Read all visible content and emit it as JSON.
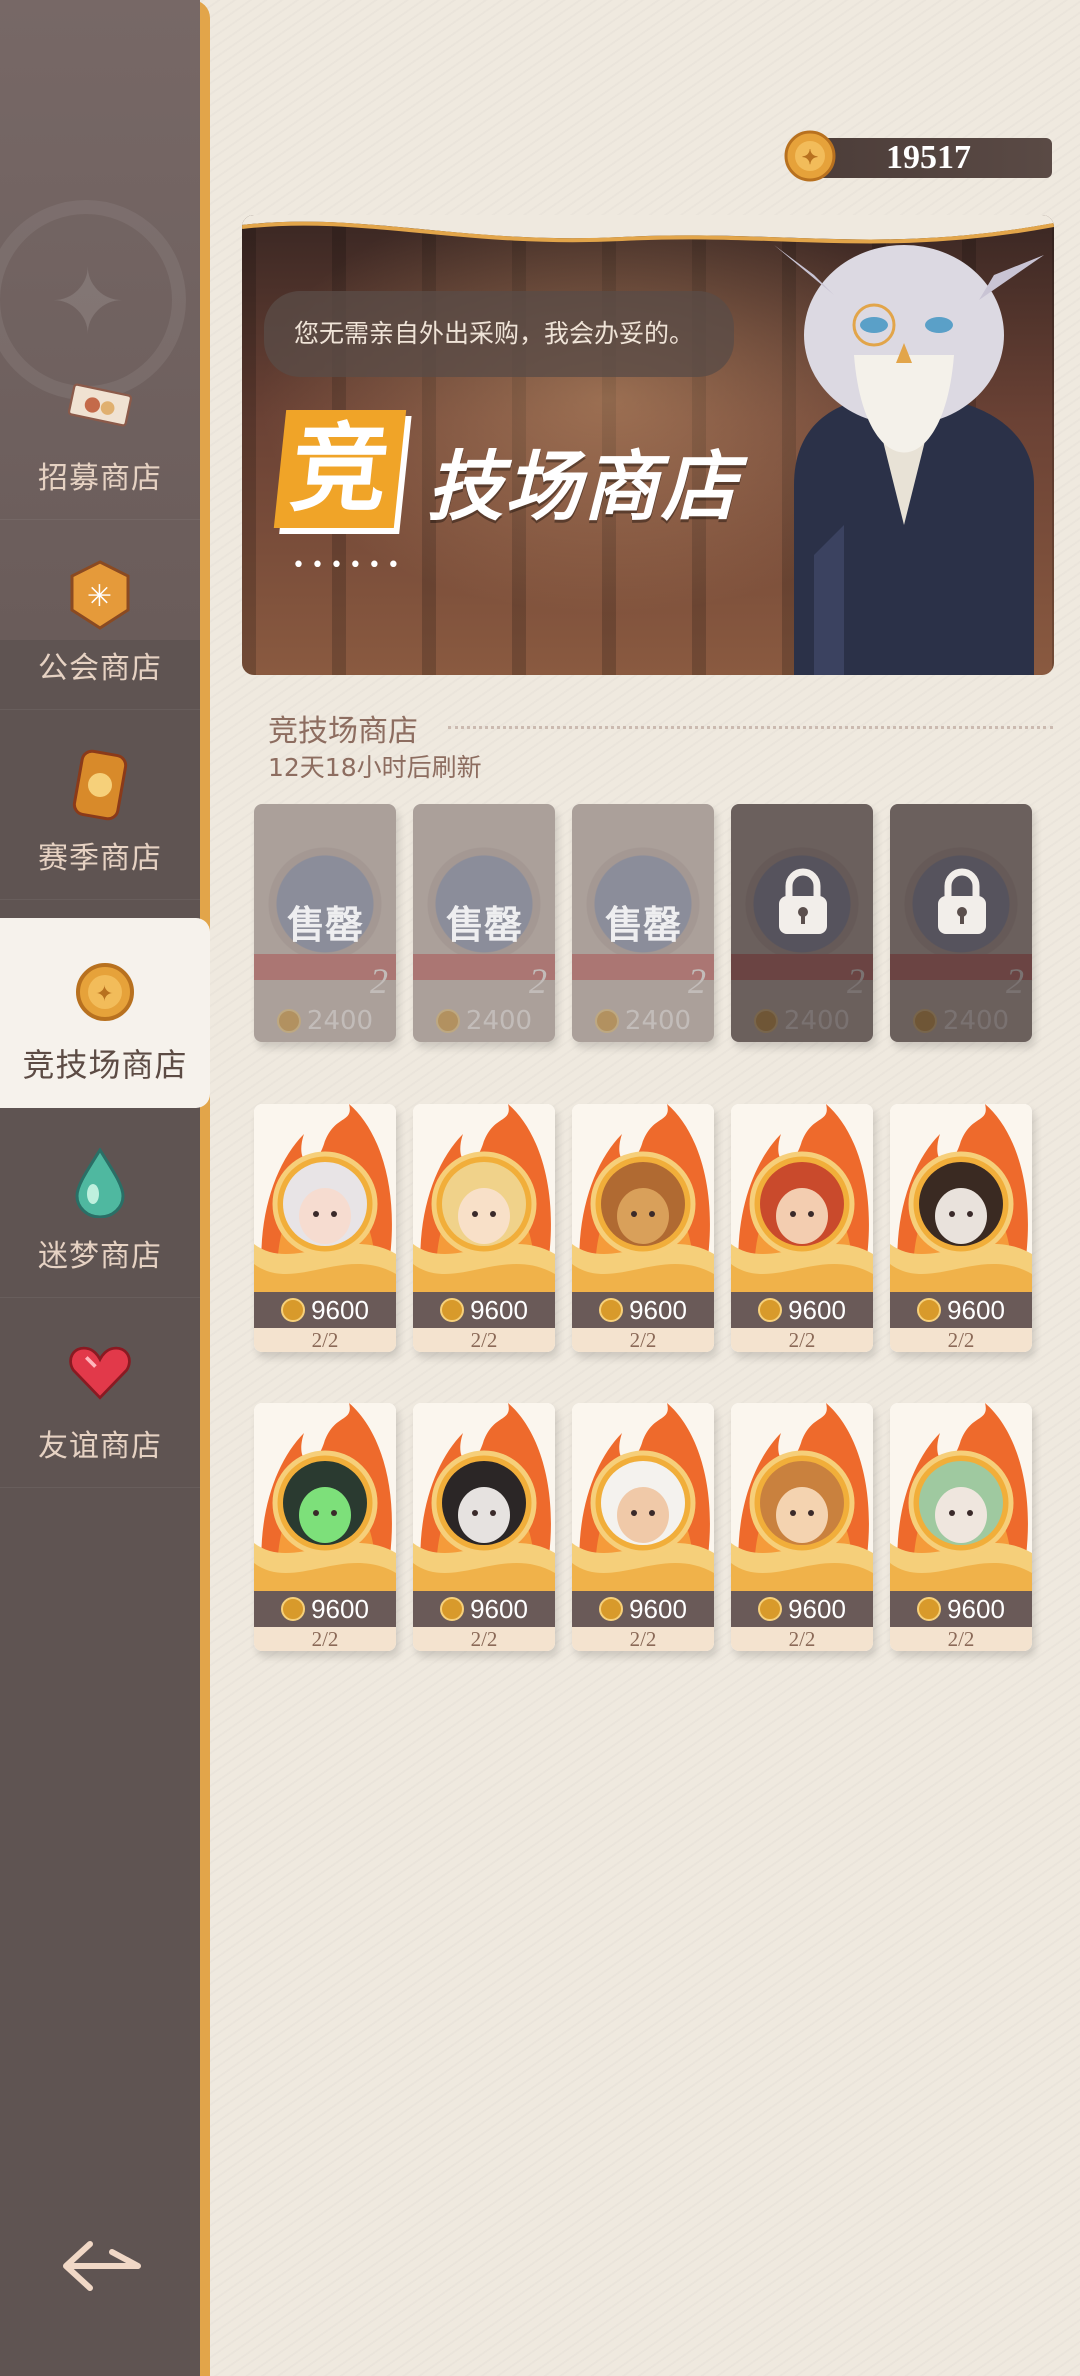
{
  "currency": {
    "amount": "19517",
    "icon": "arena-coin-icon"
  },
  "sidebar": {
    "items": [
      {
        "label": "招募商店",
        "icon": "recruit-ticket-icon"
      },
      {
        "label": "公会商店",
        "icon": "guild-badge-icon"
      },
      {
        "label": "赛季商店",
        "icon": "season-token-icon"
      },
      {
        "label": "竞技场商店",
        "icon": "arena-coin-icon",
        "active": true
      },
      {
        "label": "迷梦商店",
        "icon": "dream-drop-icon"
      },
      {
        "label": "友谊商店",
        "icon": "heart-gem-icon"
      }
    ],
    "back_icon": "back-arrow-icon"
  },
  "banner": {
    "speech": "您无需亲自外出采购，我会办妥的。",
    "title_first": "竞",
    "title_rest": "技场商店",
    "dots": "••••••"
  },
  "section": {
    "title": "竞技场商店",
    "refresh": "12天18小时后刷新"
  },
  "top_items": [
    {
      "label": "售罄",
      "qty": "2",
      "price": "2400",
      "state": "sold-out"
    },
    {
      "label": "售罄",
      "qty": "2",
      "price": "2400",
      "state": "sold-out"
    },
    {
      "label": "售罄",
      "qty": "2",
      "price": "2400",
      "state": "sold-out"
    },
    {
      "label": "",
      "qty": "2",
      "price": "2400",
      "state": "locked"
    },
    {
      "label": "",
      "qty": "2",
      "price": "2400",
      "state": "locked"
    }
  ],
  "hero_items_row1": [
    {
      "price": "9600",
      "stock": "2/2",
      "hair": "#e8e4e6",
      "skin": "#f6dcd0"
    },
    {
      "price": "9600",
      "stock": "2/2",
      "hair": "#f0d28a",
      "skin": "#f8e0c8"
    },
    {
      "price": "9600",
      "stock": "2/2",
      "hair": "#b06a32",
      "skin": "#d9a05a"
    },
    {
      "price": "9600",
      "stock": "2/2",
      "hair": "#c94a2c",
      "skin": "#f3cdb0"
    },
    {
      "price": "9600",
      "stock": "2/2",
      "hair": "#3a2a22",
      "skin": "#e9e2dc"
    }
  ],
  "hero_items_row2": [
    {
      "price": "9600",
      "stock": "2/2",
      "hair": "#2a3a30",
      "skin": "#7de07a"
    },
    {
      "price": "9600",
      "stock": "2/2",
      "hair": "#2b2626",
      "skin": "#e6e2e0"
    },
    {
      "price": "9600",
      "stock": "2/2",
      "hair": "#f4f2ee",
      "skin": "#f0c9a8"
    },
    {
      "price": "9600",
      "stock": "2/2",
      "hair": "#c9813e",
      "skin": "#f4d3b0"
    },
    {
      "price": "9600",
      "stock": "2/2",
      "hair": "#9fc9a0",
      "skin": "#efe6de"
    }
  ],
  "colors": {
    "accent": "#f0a428",
    "sidebar": "#5f5452",
    "price_bar": "#6a5a58"
  }
}
